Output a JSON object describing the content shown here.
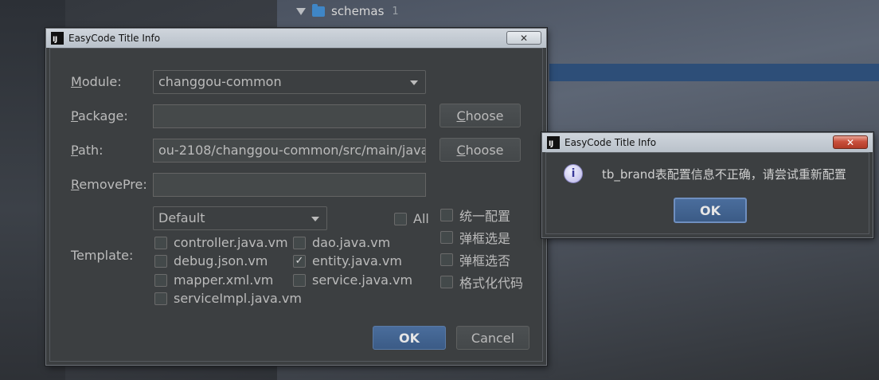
{
  "background": {
    "tree_item_label": "schemas",
    "tree_item_count": "1"
  },
  "main_dialog": {
    "title": "EasyCode Title Info",
    "close_glyph": "✕",
    "module_label": "Module:",
    "module_value": "changgou-common",
    "package_label": "Package:",
    "package_value": "",
    "path_label": "Path:",
    "path_value": "ou-2108/changgou-common/src/main/java",
    "removepre_label": "RemovePre:",
    "removepre_value": "",
    "choose_label": "Choose",
    "template_label": "Template:",
    "template_group": "Default",
    "all_label": "All",
    "templates": [
      {
        "label": "controller.java.vm",
        "checked": false
      },
      {
        "label": "dao.java.vm",
        "checked": false
      },
      {
        "label": "debug.json.vm",
        "checked": false
      },
      {
        "label": "entity.java.vm",
        "checked": true
      },
      {
        "label": "mapper.xml.vm",
        "checked": false
      },
      {
        "label": "service.java.vm",
        "checked": false
      },
      {
        "label": "serviceImpl.java.vm",
        "checked": false
      }
    ],
    "options": [
      {
        "label": "统一配置",
        "checked": false
      },
      {
        "label": "弹框选是",
        "checked": false
      },
      {
        "label": "弹框选否",
        "checked": false
      },
      {
        "label": "格式化代码",
        "checked": false
      }
    ],
    "ok_label": "OK",
    "cancel_label": "Cancel"
  },
  "message_dialog": {
    "title": "EasyCode Title Info",
    "close_glyph": "✕",
    "icon": "info-icon",
    "message": "tb_brand表配置信息不正确，请尝试重新配置",
    "ok_label": "OK"
  },
  "colors": {
    "dialog_bg": "#3c3f41",
    "primary_button": "#3b5b86",
    "titlebar": "#c4ccd4",
    "close_red": "#c9503c"
  }
}
